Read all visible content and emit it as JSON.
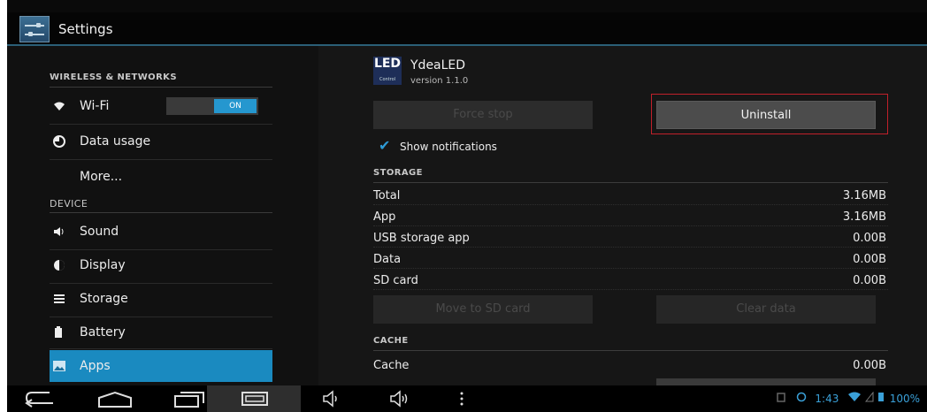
{
  "action_bar": {
    "title": "Settings",
    "icon": "settings-sliders-icon"
  },
  "sidebar": {
    "sections": [
      {
        "header": "WIRELESS & NETWORKS"
      },
      {
        "header": "DEVICE"
      }
    ],
    "items": [
      {
        "label": "Wi-Fi",
        "icon": "wifi-icon",
        "toggle": "ON"
      },
      {
        "label": "Data usage",
        "icon": "data-usage-icon"
      },
      {
        "label": "More..."
      },
      {
        "label": "Sound",
        "icon": "speaker-icon"
      },
      {
        "label": "Display",
        "icon": "display-icon"
      },
      {
        "label": "Storage",
        "icon": "storage-icon"
      },
      {
        "label": "Battery",
        "icon": "battery-icon"
      },
      {
        "label": "Apps",
        "icon": "apps-icon",
        "selected": true
      }
    ],
    "accent": "#1a8ac0"
  },
  "app": {
    "logo_text": "LED",
    "logo_subtext": "Control",
    "name": "YdeaLED",
    "version": "version 1.1.0"
  },
  "buttons": {
    "force_stop": "Force stop",
    "uninstall": "Uninstall",
    "move_to_sd": "Move to SD card",
    "clear_data": "Clear data"
  },
  "notifications": {
    "label": "Show notifications",
    "checked": true
  },
  "storage": {
    "header": "STORAGE",
    "rows": [
      {
        "label": "Total",
        "value": "3.16MB"
      },
      {
        "label": "App",
        "value": "3.16MB"
      },
      {
        "label": "USB storage app",
        "value": "0.00B"
      },
      {
        "label": "Data",
        "value": "0.00B"
      },
      {
        "label": "SD card",
        "value": "0.00B"
      }
    ]
  },
  "cache": {
    "header": "CACHE",
    "rows": [
      {
        "label": "Cache",
        "value": "0.00B"
      }
    ]
  },
  "status_bar": {
    "time": "1:43",
    "battery": "100%"
  }
}
